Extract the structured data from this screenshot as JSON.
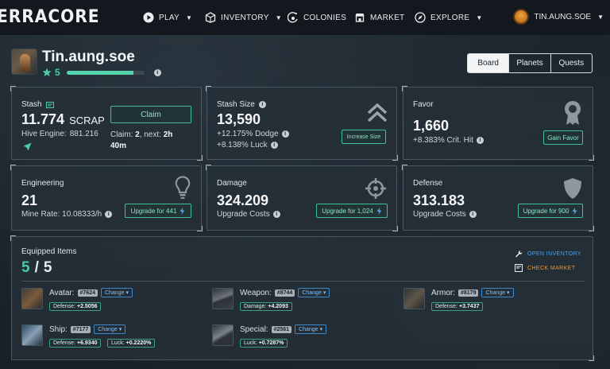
{
  "nav": {
    "logo": "ERRACORE",
    "items": [
      {
        "label": "PLAY",
        "icon": "play-icon",
        "dropdown": true
      },
      {
        "label": "INVENTORY",
        "icon": "inventory-icon",
        "dropdown": true
      },
      {
        "label": "COLONIES",
        "icon": "colonies-icon",
        "dropdown": false
      },
      {
        "label": "MARKET",
        "icon": "market-icon",
        "dropdown": false
      },
      {
        "label": "EXPLORE",
        "icon": "explore-icon",
        "dropdown": true
      }
    ],
    "user": "TIN.AUNG.SOE"
  },
  "profile": {
    "name": "Tin.aung.soe",
    "level": "5",
    "xp_fraction": 0.86,
    "tabs": [
      "Board",
      "Planets",
      "Quests"
    ],
    "active_tab": "Board"
  },
  "stash": {
    "title": "Stash",
    "value": "11.774",
    "unit": "SCRAP",
    "hive_label": "Hive Engine:",
    "hive_value": "881.216",
    "claim_label": "Claim",
    "claim_info_prefix": "Claim:",
    "claim_count": "2",
    "claim_next_label": ", next:",
    "claim_next_value": "2h",
    "claim_next_line2": "40m"
  },
  "stash_size": {
    "title": "Stash Size",
    "value": "13,590",
    "line1": "+12.175% Dodge",
    "line2": "+8.138% Luck",
    "button": "Increase Size"
  },
  "favor": {
    "title": "Favor",
    "value": "1,660",
    "line1": "+8.383% Crit. Hit",
    "button": "Gain Favor"
  },
  "engineering": {
    "title": "Engineering",
    "value": "21",
    "line1": "Mine Rate: 10.08333/h",
    "button": "Upgrade for 441"
  },
  "damage": {
    "title": "Damage",
    "value": "324.209",
    "line1": "Upgrade Costs",
    "button": "Upgrade for 1,024"
  },
  "defense": {
    "title": "Defense",
    "value": "313.183",
    "line1": "Upgrade Costs",
    "button": "Upgrade for 900"
  },
  "equipped": {
    "title": "Equipped Items",
    "count": "5",
    "slash": "/",
    "total": "5",
    "open_inventory": "OPEN INVENTORY",
    "check_market": "CHECK MARKET",
    "change_label": "Change",
    "items": [
      {
        "slot": "Avatar:",
        "id": "#7624",
        "stats": [
          {
            "k": "Defense:",
            "v": "+2.5056"
          }
        ]
      },
      {
        "slot": "Weapon:",
        "id": "#8744",
        "stats": [
          {
            "k": "Damage:",
            "v": "+4.2093"
          }
        ]
      },
      {
        "slot": "Armor:",
        "id": "#8179",
        "stats": [
          {
            "k": "Defense:",
            "v": "+3.7437"
          }
        ]
      },
      {
        "slot": "Ship:",
        "id": "#7177",
        "stats": [
          {
            "k": "Defense:",
            "v": "+6.9340"
          },
          {
            "k": "Luck:",
            "v": "+0.2220%"
          }
        ]
      },
      {
        "slot": "Special:",
        "id": "#2561",
        "stats": [
          {
            "k": "Luck:",
            "v": "+0.7287%"
          }
        ]
      }
    ]
  },
  "colors": {
    "accent": "#49c9a4",
    "link_blue": "#3d9ae8",
    "link_orange": "#e39a3a",
    "card_bg": "#263038"
  }
}
